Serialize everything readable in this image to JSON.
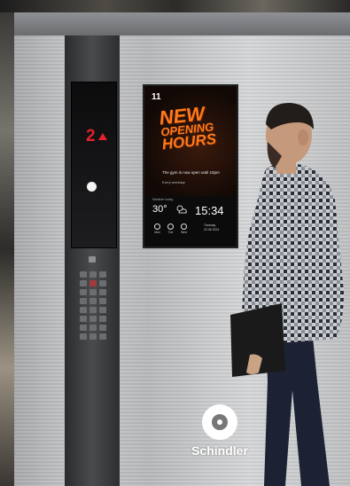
{
  "elevator_panel": {
    "floor_number": "2"
  },
  "screen": {
    "ad": {
      "logo": "11",
      "headline_line1": "NEW",
      "headline_line2": "OPENING",
      "headline_line3": "HOURS",
      "subtext": "The gym is now open until 10pm",
      "subtext2": "Every weekday"
    },
    "info": {
      "weather_label": "Weather today",
      "temperature": "30°",
      "time": "15:34",
      "forecast": [
        {
          "label": "Mon"
        },
        {
          "label": "Tue"
        },
        {
          "label": "Wed"
        }
      ],
      "date_line1": "Tuesday",
      "date_line2": "22.06.2021"
    }
  },
  "brand": {
    "name": "Schindler"
  },
  "colors": {
    "floor_indicator": "#e3222a",
    "ad_headline": "#ff7a1a"
  }
}
